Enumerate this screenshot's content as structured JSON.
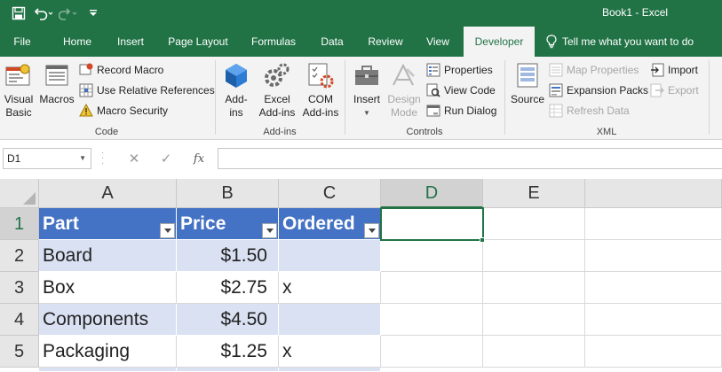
{
  "window": {
    "title": "Book1  -  Excel"
  },
  "qat": {
    "save_icon": "save-icon",
    "undo_icon": "undo-icon",
    "redo_icon": "redo-icon",
    "customize_icon": "customize-qat-icon"
  },
  "tabs": [
    {
      "label": "File"
    },
    {
      "label": "Home"
    },
    {
      "label": "Insert"
    },
    {
      "label": "Page Layout"
    },
    {
      "label": "Formulas"
    },
    {
      "label": "Data"
    },
    {
      "label": "Review"
    },
    {
      "label": "View"
    },
    {
      "label": "Developer",
      "active": true
    }
  ],
  "tell_me": "Tell me what you want to do",
  "ribbon": {
    "code": {
      "label": "Code",
      "visual_basic": "Visual\nBasic",
      "macros": "Macros",
      "record_macro": "Record Macro",
      "use_relative": "Use Relative References",
      "macro_security": "Macro Security"
    },
    "addins": {
      "label": "Add-ins",
      "addins": "Add-\nins",
      "excel_addins": "Excel\nAdd-ins",
      "com_addins": "COM\nAdd-ins"
    },
    "controls": {
      "label": "Controls",
      "insert": "Insert",
      "design_mode": "Design\nMode",
      "properties": "Properties",
      "view_code": "View Code",
      "run_dialog": "Run Dialog"
    },
    "xml": {
      "label": "XML",
      "source": "Source",
      "map_properties": "Map Properties",
      "expansion_packs": "Expansion Packs",
      "refresh_data": "Refresh Data",
      "import": "Import",
      "export": "Export"
    }
  },
  "formula_bar": {
    "name_box": "D1",
    "fx": "fx",
    "value": ""
  },
  "colors": {
    "brand": "#217346",
    "table_header": "#4472c4",
    "table_band": "#d9e1f2"
  },
  "grid": {
    "columns": [
      "A",
      "B",
      "C",
      "D",
      "E"
    ],
    "rows": [
      "1",
      "2",
      "3",
      "4",
      "5"
    ],
    "cells": {
      "A1": "Part",
      "B1": "Price",
      "C1": "Ordered",
      "A2": "Board",
      "B2": "$1.50",
      "C2": "",
      "A3": "Box",
      "B3": "$2.75",
      "C3": "x",
      "A4": "Components",
      "B4": "$4.50",
      "C4": "",
      "A5": "Packaging",
      "B5": "$1.25",
      "C5": "x"
    },
    "active_cell": "D1"
  }
}
